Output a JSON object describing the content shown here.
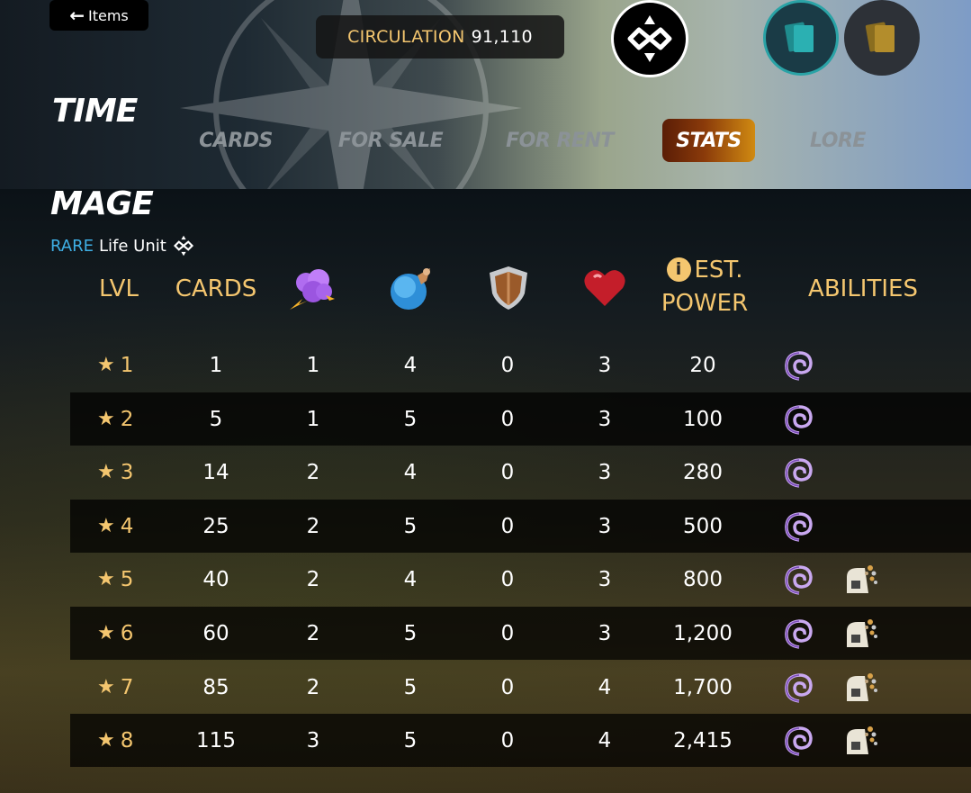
{
  "header": {
    "back_label": "Items",
    "circulation_label": "CIRCULATION",
    "circulation_value": "91,110",
    "set_title": "TIME",
    "tabs": [
      {
        "label": "CARDS",
        "active": false
      },
      {
        "label": "FOR SALE",
        "active": false
      },
      {
        "label": "FOR RENT",
        "active": false
      },
      {
        "label": "STATS",
        "active": true
      },
      {
        "label": "LORE",
        "active": false
      }
    ],
    "icons": [
      "edition-logo-icon",
      "regular-card-icon",
      "gold-card-icon"
    ]
  },
  "card": {
    "name": "MAGE",
    "rarity": "RARE",
    "type": "Life Unit"
  },
  "table": {
    "columns": {
      "lvl": "LVL",
      "cards": "CARDS",
      "mana": "mana-icon",
      "magic": "magic-icon",
      "armor": "armor-icon",
      "health": "health-icon",
      "est_power_line1": "EST.",
      "est_power_line2": "POWER",
      "abilities": "ABILITIES"
    },
    "rows": [
      {
        "lvl": "1",
        "cards": "1",
        "mana": "1",
        "magic": "4",
        "armor": "0",
        "health": "3",
        "power": "20",
        "abilities": [
          "affliction-icon"
        ]
      },
      {
        "lvl": "2",
        "cards": "5",
        "mana": "1",
        "magic": "5",
        "armor": "0",
        "health": "3",
        "power": "100",
        "abilities": [
          "affliction-icon"
        ]
      },
      {
        "lvl": "3",
        "cards": "14",
        "mana": "2",
        "magic": "4",
        "armor": "0",
        "health": "3",
        "power": "280",
        "abilities": [
          "affliction-icon"
        ]
      },
      {
        "lvl": "4",
        "cards": "25",
        "mana": "2",
        "magic": "5",
        "armor": "0",
        "health": "3",
        "power": "500",
        "abilities": [
          "affliction-icon"
        ]
      },
      {
        "lvl": "5",
        "cards": "40",
        "mana": "2",
        "magic": "4",
        "armor": "0",
        "health": "3",
        "power": "800",
        "abilities": [
          "affliction-icon",
          "dispel-icon"
        ]
      },
      {
        "lvl": "6",
        "cards": "60",
        "mana": "2",
        "magic": "5",
        "armor": "0",
        "health": "3",
        "power": "1,200",
        "abilities": [
          "affliction-icon",
          "dispel-icon"
        ]
      },
      {
        "lvl": "7",
        "cards": "85",
        "mana": "2",
        "magic": "5",
        "armor": "0",
        "health": "4",
        "power": "1,700",
        "abilities": [
          "affliction-icon",
          "dispel-icon"
        ]
      },
      {
        "lvl": "8",
        "cards": "115",
        "mana": "3",
        "magic": "5",
        "armor": "0",
        "health": "4",
        "power": "2,415",
        "abilities": [
          "affliction-icon",
          "dispel-icon"
        ]
      }
    ]
  },
  "colors": {
    "accent_gold": "#f4c66f",
    "rarity_blue": "#3fb0e6",
    "active_tab_start": "#5a1d06",
    "active_tab_end": "#d08a12"
  }
}
